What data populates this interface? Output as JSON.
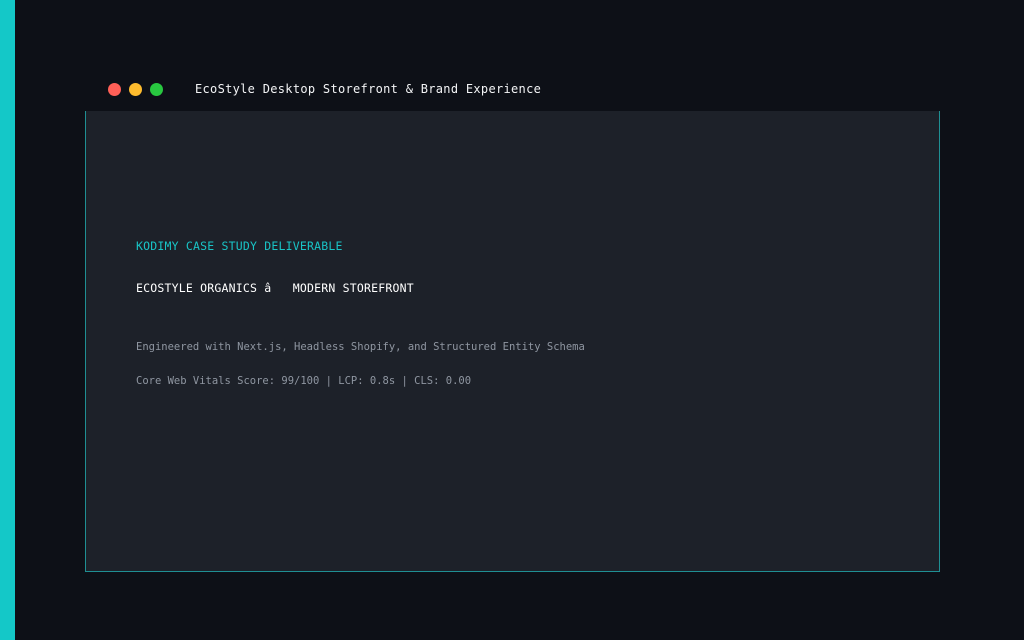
{
  "colors": {
    "accent": "#14c8c8",
    "background": "#0d1017",
    "panel": "#1d2129",
    "panel_border": "#1f8f93",
    "dot_red": "#ff5f57",
    "dot_yellow": "#febc2e",
    "dot_green": "#28c840"
  },
  "window": {
    "title": "EcoStyle Desktop Storefront & Brand Experience",
    "controls": [
      "close-dot",
      "minimize-dot",
      "maximize-dot"
    ]
  },
  "content": {
    "eyebrow": "KODIMY CASE STUDY DELIVERABLE",
    "headline": "ECOSTYLE ORGANICS â   MODERN STOREFRONT",
    "tech_line": "Engineered with Next.js, Headless Shopify, and Structured Entity Schema",
    "metrics_line": "Core Web Vitals Score: 99/100 | LCP: 0.8s | CLS: 0.00"
  }
}
